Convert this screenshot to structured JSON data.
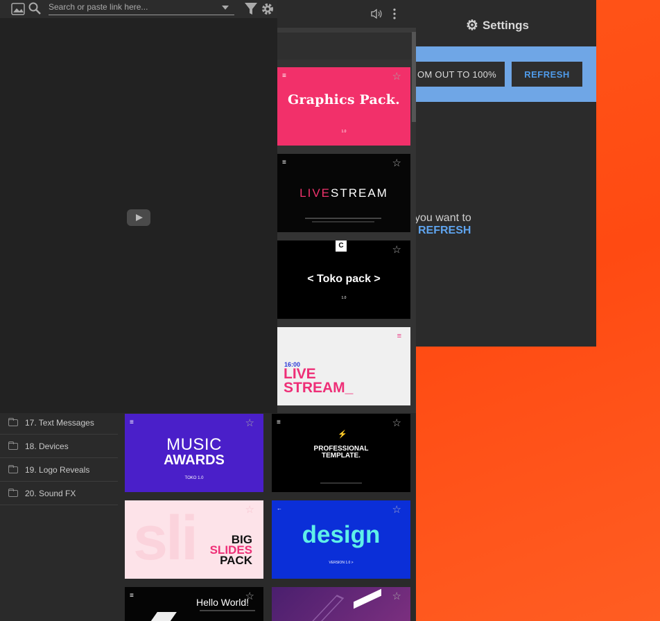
{
  "toolbar": {
    "search_placeholder": "Search or paste link here..."
  },
  "settings": {
    "title": "Settings",
    "zoom_label": "OM OUT TO 100%",
    "refresh_label": "REFRESH",
    "message_line1": "you want to",
    "message_line2": "REFRESH"
  },
  "sidebar": {
    "items": [
      {
        "label": "17. Text Messages"
      },
      {
        "label": "18. Devices"
      },
      {
        "label": "19. Logo Reveals"
      },
      {
        "label": "20. Sound FX"
      }
    ]
  },
  "thumbnails": {
    "graphics_pack": {
      "title": "Graphics Pack.",
      "sub": "1.0"
    },
    "livestream_dark": {
      "title_a": "LIVE",
      "title_b": "STREAM"
    },
    "toko_pack": {
      "badge": "C",
      "title": "< Toko pack >",
      "sub": "1.0"
    },
    "livestream_light": {
      "time": "16:00",
      "title_a": "LIVE",
      "title_b": "STREAM_"
    },
    "music_awards": {
      "title_a": "MUSIC",
      "title_b": "AWARDS",
      "sub": "TOKO 1.0"
    },
    "professional": {
      "title": "PROFESSIONAL TEMPLATE."
    },
    "big_slides": {
      "l1": "BIG",
      "l2": "SLIDES",
      "l3": "PACK"
    },
    "design": {
      "title": "design",
      "sub": "VERSION 1.0 >"
    },
    "hello_world": {
      "title": "Hello World!"
    }
  },
  "colors": {
    "accent_blue": "#6fa6e6",
    "refresh_text": "#4f9bea",
    "background_orange": "#ff4d17"
  }
}
